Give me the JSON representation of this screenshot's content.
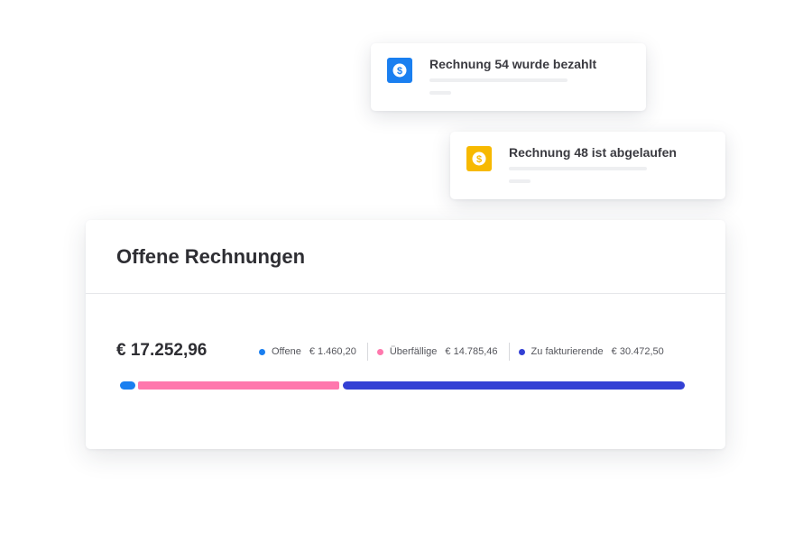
{
  "notifications": [
    {
      "title": "Rechnung 54 wurde bezahlt",
      "icon": "dollar-coin-icon",
      "color": "#1a7ff0"
    },
    {
      "title": "Rechnung 48 ist abgelaufen",
      "icon": "dollar-coin-icon",
      "color": "#f7b900"
    }
  ],
  "card": {
    "title": "Offene Rechnungen",
    "total": "€ 17.252,96",
    "legend": [
      {
        "label": "Offene",
        "value": "€ 1.460,20",
        "color": "#1a7ff0"
      },
      {
        "label": "Überfällige",
        "value": "€ 14.785,46",
        "color": "#ff78ad"
      },
      {
        "label": "Zu fakturierende",
        "value": "€ 30.472,50",
        "color": "#3340d4"
      }
    ]
  }
}
